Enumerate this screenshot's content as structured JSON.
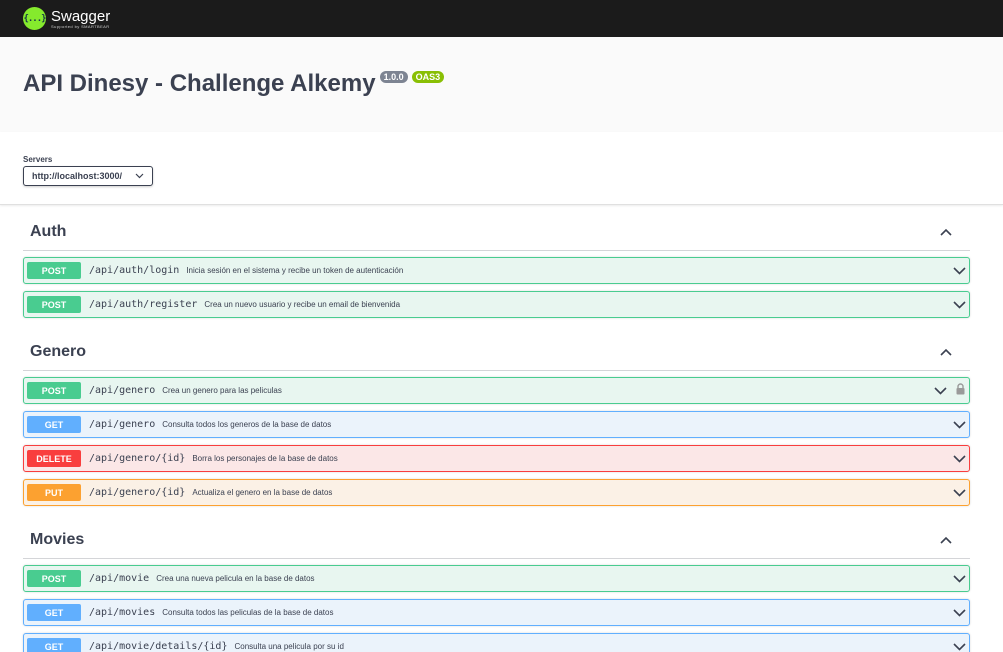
{
  "brand": {
    "name": "Swagger",
    "sub": "Supported by SMARTBEAR",
    "mark": "{...}",
    "accent": "#85ea2d"
  },
  "info": {
    "title": "API Dinesy - Challenge Alkemy",
    "version": "1.0.0",
    "oas": "OAS3"
  },
  "servers": {
    "label": "Servers",
    "selected": "http://localhost:3000/"
  },
  "tags": [
    {
      "name": "Auth",
      "operations": [
        {
          "method": "POST",
          "path": "/api/auth/login",
          "summary": "Inicia sesión en el sistema y recibe un token de autenticación"
        },
        {
          "method": "POST",
          "path": "/api/auth/register",
          "summary": "Crea un nuevo usuario y recibe un email de bienvenida"
        }
      ]
    },
    {
      "name": "Genero",
      "operations": [
        {
          "method": "POST",
          "path": "/api/genero",
          "summary": "Crea un genero para las peliculas",
          "locked": true
        },
        {
          "method": "GET",
          "path": "/api/genero",
          "summary": "Consulta todos los generos de la base de datos"
        },
        {
          "method": "DELETE",
          "path": "/api/genero/{id}",
          "summary": "Borra los personajes de la base de datos"
        },
        {
          "method": "PUT",
          "path": "/api/genero/{id}",
          "summary": "Actualiza el genero en la base de datos"
        }
      ]
    },
    {
      "name": "Movies",
      "operations": [
        {
          "method": "POST",
          "path": "/api/movie",
          "summary": "Crea una nueva pelicula en la base de datos"
        },
        {
          "method": "GET",
          "path": "/api/movies",
          "summary": "Consulta todos las peliculas de la base de datos"
        },
        {
          "method": "GET",
          "path": "/api/movie/details/{id}",
          "summary": "Consulta una pelicula por su id"
        }
      ]
    }
  ],
  "colors": {
    "post": "#49cc90",
    "get": "#61affe",
    "delete": "#f93e3e",
    "put": "#fca130"
  }
}
